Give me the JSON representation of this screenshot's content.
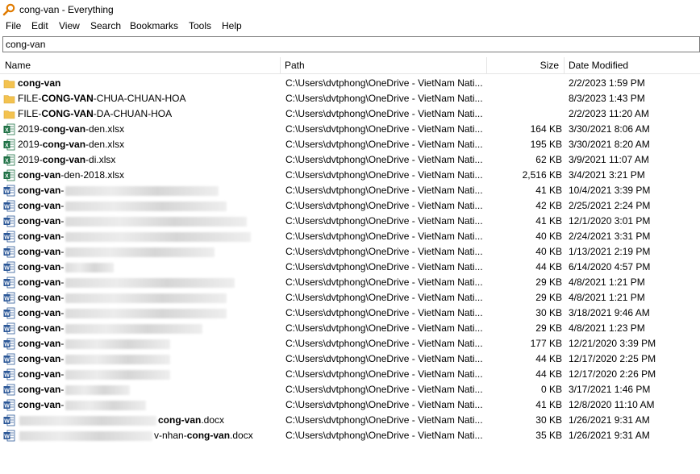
{
  "window": {
    "title": "cong-van - Everything",
    "icon": "magnifier-icon"
  },
  "menu": [
    "File",
    "Edit",
    "View",
    "Search",
    "Bookmarks",
    "Tools",
    "Help"
  ],
  "search": {
    "value": "cong-van"
  },
  "columns": {
    "name": "Name",
    "path": "Path",
    "size": "Size",
    "date": "Date Modified"
  },
  "rows": [
    {
      "type": "folder",
      "pre": "",
      "bold": "cong-van",
      "post": "",
      "path": "C:\\Users\\dvtphong\\OneDrive - VietNam Nati...",
      "size": "",
      "date": "2/2/2023 1:59 PM"
    },
    {
      "type": "folder",
      "pre": "FILE-",
      "bold": "CONG-VAN",
      "post": "-CHUA-CHUAN-HOA",
      "path": "C:\\Users\\dvtphong\\OneDrive - VietNam Nati...",
      "size": "",
      "date": "8/3/2023 1:43 PM"
    },
    {
      "type": "folder",
      "pre": "FILE-",
      "bold": "CONG-VAN",
      "post": "-DA-CHUAN-HOA",
      "path": "C:\\Users\\dvtphong\\OneDrive - VietNam Nati...",
      "size": "",
      "date": "2/2/2023 11:20 AM"
    },
    {
      "type": "excel",
      "pre": "2019-",
      "bold": "cong-van",
      "post": "-den.xlsx",
      "path": "C:\\Users\\dvtphong\\OneDrive - VietNam Nati...",
      "size": "164 KB",
      "date": "3/30/2021 8:06 AM"
    },
    {
      "type": "excel",
      "pre": "2019-",
      "bold": "cong-van",
      "post": "-den.xlsx",
      "path": "C:\\Users\\dvtphong\\OneDrive - VietNam Nati...",
      "size": "195 KB",
      "date": "3/30/2021 8:20 AM"
    },
    {
      "type": "excel",
      "pre": "2019-",
      "bold": "cong-van",
      "post": "-di.xlsx",
      "path": "C:\\Users\\dvtphong\\OneDrive - VietNam Nati...",
      "size": "62 KB",
      "date": "3/9/2021 11:07 AM"
    },
    {
      "type": "excel",
      "pre": "",
      "bold": "cong-van",
      "post": "-den-2018.xlsx",
      "path": "C:\\Users\\dvtphong\\OneDrive - VietNam Nati...",
      "size": "2,516 KB",
      "date": "3/4/2021 3:21 PM"
    },
    {
      "type": "word",
      "pre": "",
      "bold": "cong-van",
      "post": "-",
      "path": "C:\\Users\\dvtphong\\OneDrive - VietNam Nati...",
      "size": "41 KB",
      "date": "10/4/2021 3:39 PM"
    },
    {
      "type": "word",
      "pre": "",
      "bold": "cong-van",
      "post": "-",
      "path": "C:\\Users\\dvtphong\\OneDrive - VietNam Nati...",
      "size": "42 KB",
      "date": "2/25/2021 2:24 PM"
    },
    {
      "type": "word",
      "pre": "",
      "bold": "cong-van",
      "post": "-",
      "path": "C:\\Users\\dvtphong\\OneDrive - VietNam Nati...",
      "size": "41 KB",
      "date": "12/1/2020 3:01 PM"
    },
    {
      "type": "word",
      "pre": "",
      "bold": "cong-van",
      "post": "-",
      "path": "C:\\Users\\dvtphong\\OneDrive - VietNam Nati...",
      "size": "40 KB",
      "date": "2/24/2021 3:31 PM"
    },
    {
      "type": "word",
      "pre": "",
      "bold": "cong-van",
      "post": "-",
      "path": "C:\\Users\\dvtphong\\OneDrive - VietNam Nati...",
      "size": "40 KB",
      "date": "1/13/2021 2:19 PM"
    },
    {
      "type": "word",
      "pre": "",
      "bold": "cong-van",
      "post": "-",
      "path": "C:\\Users\\dvtphong\\OneDrive - VietNam Nati...",
      "size": "44 KB",
      "date": "6/14/2020 4:57 PM"
    },
    {
      "type": "word",
      "pre": "",
      "bold": "cong-van",
      "post": "-",
      "path": "C:\\Users\\dvtphong\\OneDrive - VietNam Nati...",
      "size": "29 KB",
      "date": "4/8/2021 1:21 PM"
    },
    {
      "type": "word",
      "pre": "",
      "bold": "cong-van",
      "post": "-",
      "path": "C:\\Users\\dvtphong\\OneDrive - VietNam Nati...",
      "size": "29 KB",
      "date": "4/8/2021 1:21 PM"
    },
    {
      "type": "word",
      "pre": "",
      "bold": "cong-van",
      "post": "-",
      "path": "C:\\Users\\dvtphong\\OneDrive - VietNam Nati...",
      "size": "30 KB",
      "date": "3/18/2021 9:46 AM"
    },
    {
      "type": "word",
      "pre": "",
      "bold": "cong-van",
      "post": "-",
      "path": "C:\\Users\\dvtphong\\OneDrive - VietNam Nati...",
      "size": "29 KB",
      "date": "4/8/2021 1:23 PM"
    },
    {
      "type": "word",
      "pre": "",
      "bold": "cong-van",
      "post": "-",
      "path": "C:\\Users\\dvtphong\\OneDrive - VietNam Nati...",
      "size": "177 KB",
      "date": "12/21/2020 3:39 PM"
    },
    {
      "type": "word",
      "pre": "",
      "bold": "cong-van",
      "post": "-",
      "path": "C:\\Users\\dvtphong\\OneDrive - VietNam Nati...",
      "size": "44 KB",
      "date": "12/17/2020 2:25 PM"
    },
    {
      "type": "word",
      "pre": "",
      "bold": "cong-van",
      "post": "-",
      "path": "C:\\Users\\dvtphong\\OneDrive - VietNam Nati...",
      "size": "44 KB",
      "date": "12/17/2020 2:26 PM"
    },
    {
      "type": "word",
      "pre": "",
      "bold": "cong-van",
      "post": "-",
      "path": "C:\\Users\\dvtphong\\OneDrive - VietNam Nati...",
      "size": "0 KB",
      "date": "3/17/2021 1:46 PM"
    },
    {
      "type": "word",
      "pre": "",
      "bold": "cong-van",
      "post": "-",
      "path": "C:\\Users\\dvtphong\\OneDrive - VietNam Nati...",
      "size": "41 KB",
      "date": "12/8/2020 11:10 AM"
    },
    {
      "type": "word",
      "pre": "",
      "bold": "cong-van",
      "post": ".docx",
      "path": "C:\\Users\\dvtphong\\OneDrive - VietNam Nati...",
      "size": "30 KB",
      "date": "1/26/2021 9:31 AM"
    },
    {
      "type": "word",
      "pre": "v-nhan-",
      "bold": "cong-van",
      "post": ".docx",
      "path": "C:\\Users\\dvtphong\\OneDrive - VietNam Nati...",
      "size": "35 KB",
      "date": "1/26/2021 9:31 AM"
    }
  ],
  "colors": {
    "folder": "#f3c24f",
    "excel": "#1d7044",
    "word": "#2b5797"
  }
}
